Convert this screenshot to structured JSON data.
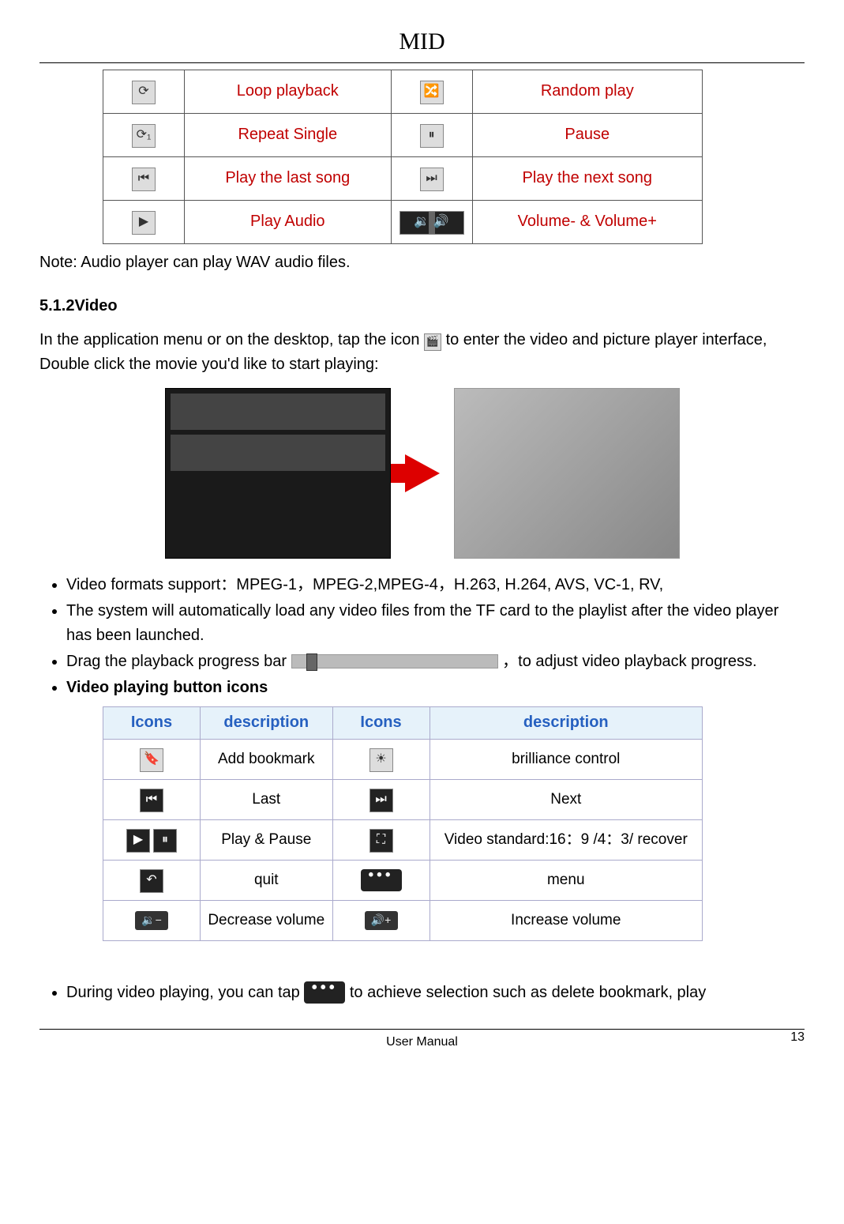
{
  "header": {
    "title": "MID"
  },
  "audio_table": {
    "rows": [
      {
        "left": "Loop playback",
        "right": "Random play"
      },
      {
        "left": "Repeat Single",
        "right": "Pause"
      },
      {
        "left": "Play the last song",
        "right": "Play the next song"
      },
      {
        "left": "Play Audio",
        "right": "Volume- & Volume+"
      }
    ]
  },
  "note": "Note: Audio player can play WAV audio files.",
  "section_video": "5.1.2Video",
  "video_intro_1": "In the application menu or on the desktop, tap the icon ",
  "video_intro_2": " to enter the video and picture player interface, Double click the movie you'd like to start playing:",
  "bullets": {
    "formats": "Video formats support：MPEG-1，MPEG-2,MPEG-4，H.263, H.264, AVS, VC-1, RV,",
    "autoload": "The system will automatically load any video files from the TF card to the playlist after the video player has been launched.",
    "drag_a": "Drag the playback progress bar ",
    "drag_b": "，to adjust video playback progress.",
    "buttons_heading": "Video playing button icons"
  },
  "video_table": {
    "headers": {
      "icons": "Icons",
      "desc": "description"
    },
    "rows": [
      {
        "l": "Add bookmark",
        "r": "brilliance control"
      },
      {
        "l": "Last",
        "r": "Next"
      },
      {
        "l": "Play & Pause",
        "r": "Video standard:16：9 /4：3/ recover"
      },
      {
        "l": "quit",
        "r": "menu"
      },
      {
        "l": "Decrease volume",
        "r": "Increase volume"
      }
    ]
  },
  "closing": {
    "a": "During video playing, you can tap ",
    "b": " to achieve selection such as delete bookmark, play"
  },
  "footer": {
    "label": "User Manual",
    "page": "13"
  }
}
